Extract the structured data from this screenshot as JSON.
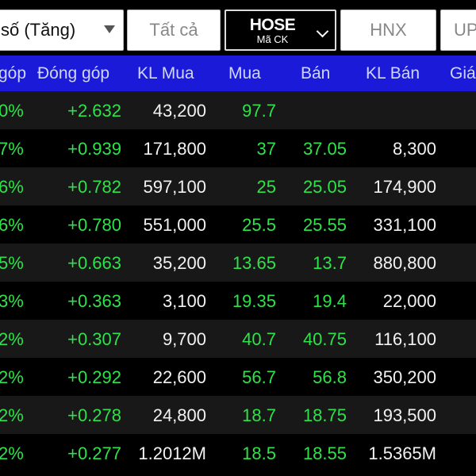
{
  "toolbar": {
    "sort_label": "số (Tăng)",
    "filter_all": "Tất cả",
    "exchange_selected": "HOSE",
    "exchange_sub": "Mã CK",
    "tab_hnx": "HNX",
    "tab_upcom_partial": "UP"
  },
  "columns": {
    "pct_contrib": "góp",
    "contrib": "Đóng góp",
    "buy_vol": "KL Mua",
    "buy": "Mua",
    "sell": "Bán",
    "sell_vol": "KL Bán",
    "price": "Giá"
  },
  "rows": [
    {
      "pct": "0%",
      "contrib": "+2.632",
      "buy_vol": "43,200",
      "buy": "97.7",
      "sell": "",
      "sell_vol": ""
    },
    {
      "pct": "7%",
      "contrib": "+0.939",
      "buy_vol": "171,800",
      "buy": "37",
      "sell": "37.05",
      "sell_vol": "8,300"
    },
    {
      "pct": "6%",
      "contrib": "+0.782",
      "buy_vol": "597,100",
      "buy": "25",
      "sell": "25.05",
      "sell_vol": "174,900"
    },
    {
      "pct": "6%",
      "contrib": "+0.780",
      "buy_vol": "551,000",
      "buy": "25.5",
      "sell": "25.55",
      "sell_vol": "331,100"
    },
    {
      "pct": "5%",
      "contrib": "+0.663",
      "buy_vol": "35,200",
      "buy": "13.65",
      "sell": "13.7",
      "sell_vol": "880,800"
    },
    {
      "pct": "3%",
      "contrib": "+0.363",
      "buy_vol": "3,100",
      "buy": "19.35",
      "sell": "19.4",
      "sell_vol": "22,000"
    },
    {
      "pct": "2%",
      "contrib": "+0.307",
      "buy_vol": "9,700",
      "buy": "40.7",
      "sell": "40.75",
      "sell_vol": "116,100"
    },
    {
      "pct": "2%",
      "contrib": "+0.292",
      "buy_vol": "22,600",
      "buy": "56.7",
      "sell": "56.8",
      "sell_vol": "350,200"
    },
    {
      "pct": "2%",
      "contrib": "+0.278",
      "buy_vol": "24,800",
      "buy": "18.7",
      "sell": "18.75",
      "sell_vol": "193,500"
    },
    {
      "pct": "2%",
      "contrib": "+0.277",
      "buy_vol": "1.2012M",
      "buy": "18.5",
      "sell": "18.55",
      "sell_vol": "1.5365M"
    }
  ],
  "colors": {
    "header_bg": "#1a1ad8",
    "positive": "#2ee24a",
    "neutral": "#f2f2f2"
  }
}
